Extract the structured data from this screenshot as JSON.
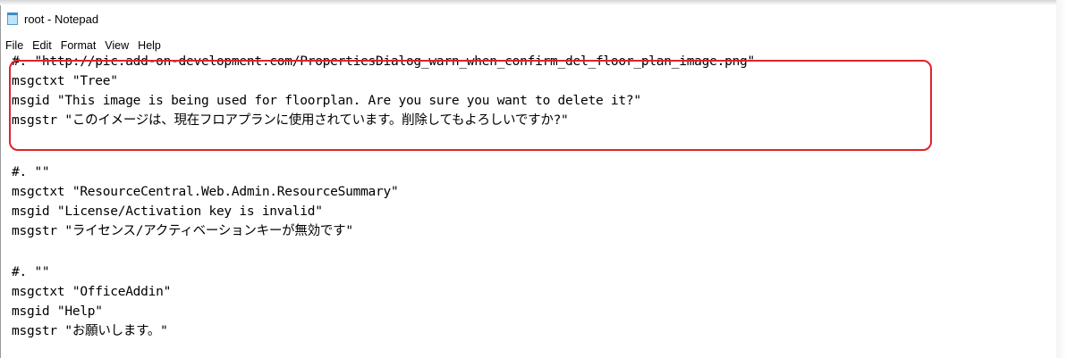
{
  "window": {
    "title": "root - Notepad"
  },
  "menu": [
    "File",
    "Edit",
    "Format",
    "View",
    "Help"
  ],
  "lines": [
    "#. \"http://pic.add-on-development.com/PropertiesDialog_warn_when_confirm_del_floor_plan_image.png\"",
    "msgctxt \"Tree\"",
    "msgid \"This image is being used for floorplan. Are you sure you want to delete it?\"",
    "msgstr \"このイメージは、現在フロアプランに使用されています。削除してもよろしいですか?\"",
    "",
    "#. \"\"",
    "msgctxt \"ResourceCentral.Web.Admin.ResourceSummary\"",
    "msgid \"License/Activation key is invalid\"",
    "msgstr \"ライセンス/アクティベーションキーが無効です\"",
    "",
    "#. \"\"",
    "msgctxt \"OfficeAddin\"",
    "msgid \"Help\"",
    "msgstr \"お願いします。\""
  ],
  "colors": {
    "highlight": "#e0232b",
    "text": "#000000",
    "background": "#ffffff"
  }
}
